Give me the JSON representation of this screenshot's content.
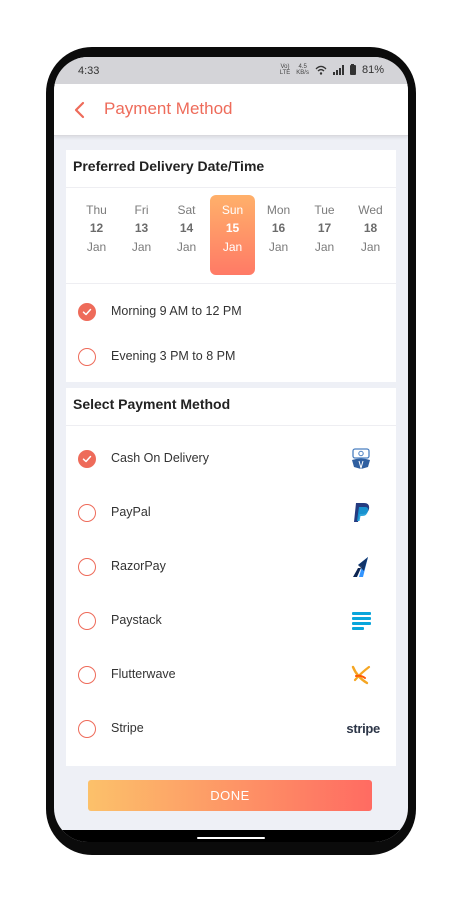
{
  "status": {
    "time": "4:33",
    "battery": "81%",
    "network_top": "Vo)",
    "network_bottom": "LTE",
    "speed_top": "4.5",
    "speed_bottom": "KB/s"
  },
  "appbar": {
    "title": "Payment Method"
  },
  "delivery": {
    "title": "Preferred Delivery Date/Time",
    "days": [
      {
        "name": "Thu",
        "num": "12",
        "month": "Jan"
      },
      {
        "name": "Fri",
        "num": "13",
        "month": "Jan"
      },
      {
        "name": "Sat",
        "num": "14",
        "month": "Jan"
      },
      {
        "name": "Sun",
        "num": "15",
        "month": "Jan"
      },
      {
        "name": "Mon",
        "num": "16",
        "month": "Jan"
      },
      {
        "name": "Tue",
        "num": "17",
        "month": "Jan"
      },
      {
        "name": "Wed",
        "num": "18",
        "month": "Jan"
      }
    ],
    "selected_day": "Sun",
    "slots": [
      {
        "label": "Morning 9 AM to 12 PM",
        "checked": true
      },
      {
        "label": "Evening 3 PM to 8 PM",
        "checked": false
      }
    ]
  },
  "payment": {
    "title": "Select Payment Method",
    "methods": [
      {
        "label": "Cash On Delivery",
        "icon": "cash-on-delivery-icon",
        "checked": true
      },
      {
        "label": "PayPal",
        "icon": "paypal-icon",
        "checked": false
      },
      {
        "label": "RazorPay",
        "icon": "razorpay-icon",
        "checked": false
      },
      {
        "label": "Paystack",
        "icon": "paystack-icon",
        "checked": false
      },
      {
        "label": "Flutterwave",
        "icon": "flutterwave-icon",
        "checked": false
      },
      {
        "label": "Stripe",
        "icon": "stripe-logo",
        "checked": false,
        "logo_text": "stripe"
      }
    ]
  },
  "done_label": "DONE",
  "colors": {
    "accent": "#ee6b5a",
    "gradient_start": "#fcc16a",
    "gradient_end": "#ff6b62"
  }
}
